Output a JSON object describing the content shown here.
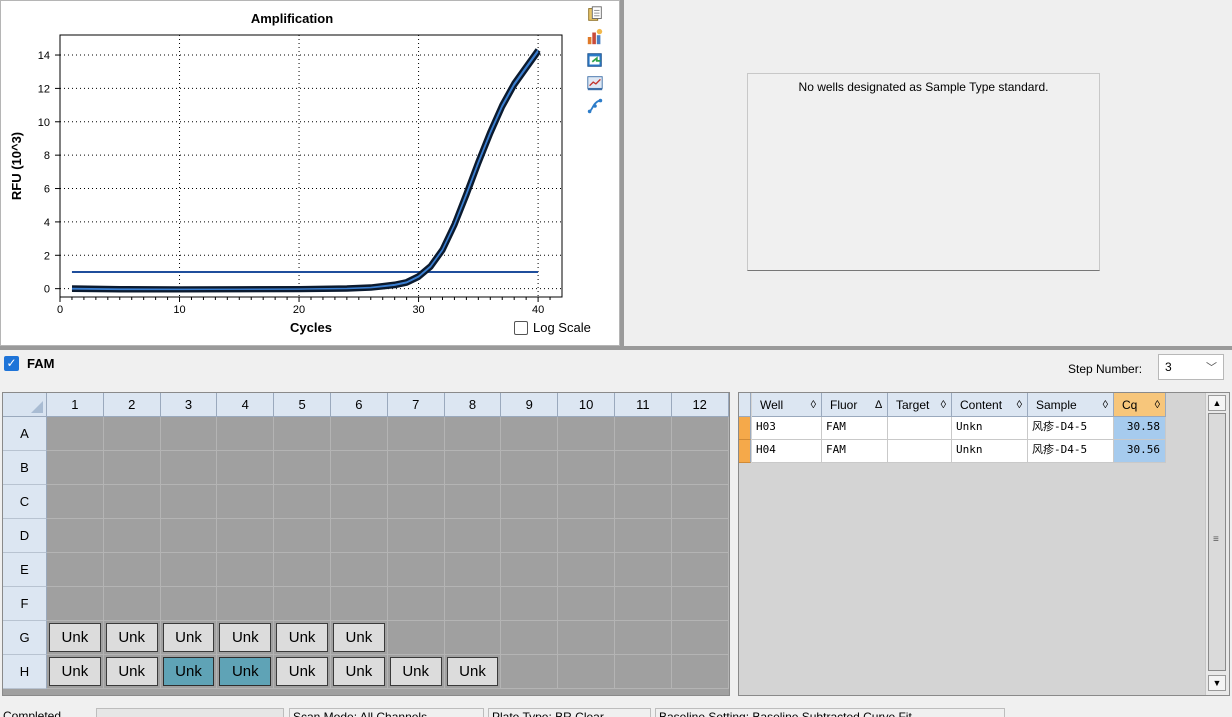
{
  "amplification": {
    "title": "Amplification",
    "log_scale_label": "Log Scale",
    "log_scale_checked": false,
    "toolbar_icons": [
      "copy-icon",
      "export-chart-icon",
      "refresh-icon",
      "chart-settings-icon",
      "curve-icon"
    ]
  },
  "chart_data": {
    "type": "line",
    "title": "Amplification",
    "xlabel": "Cycles",
    "ylabel": "RFU (10^3)",
    "xlim": [
      0,
      42
    ],
    "ylim": [
      -0.5,
      15.2
    ],
    "x_ticks": [
      0,
      10,
      20,
      30,
      40
    ],
    "y_ticks": [
      0,
      2,
      4,
      6,
      8,
      10,
      12,
      14
    ],
    "grid": true,
    "series": [
      {
        "x": [
          1,
          5,
          10,
          15,
          20,
          24,
          26,
          28,
          29,
          30,
          31,
          32,
          33,
          34,
          35,
          36,
          37,
          38,
          39,
          40
        ],
        "y": [
          -0.02,
          -0.05,
          -0.05,
          -0.04,
          -0.03,
          0.0,
          0.05,
          0.2,
          0.35,
          0.7,
          1.3,
          2.3,
          3.8,
          5.6,
          7.5,
          9.3,
          10.9,
          12.2,
          13.2,
          14.2
        ]
      },
      {
        "x": [
          1,
          5,
          10,
          15,
          20,
          24,
          26,
          28,
          29,
          30,
          31,
          32,
          33,
          34,
          35,
          36,
          37,
          38,
          39,
          40
        ],
        "y": [
          0.02,
          -0.02,
          -0.03,
          -0.03,
          -0.02,
          0.02,
          0.08,
          0.25,
          0.4,
          0.75,
          1.35,
          2.35,
          3.85,
          5.7,
          7.6,
          9.4,
          11.0,
          12.3,
          13.3,
          14.3
        ]
      }
    ],
    "threshold": 1.0,
    "threshold_x": [
      1,
      40
    ]
  },
  "standard_curve": {
    "message": "No wells designated as Sample Type standard."
  },
  "fluor": {
    "name": "FAM",
    "checked": true,
    "step_label": "Step Number:",
    "step_value": "3"
  },
  "plate": {
    "columns": [
      "1",
      "2",
      "3",
      "4",
      "5",
      "6",
      "7",
      "8",
      "9",
      "10",
      "11",
      "12"
    ],
    "rows": [
      "A",
      "B",
      "C",
      "D",
      "E",
      "F",
      "G",
      "H"
    ],
    "wells": [
      {
        "row": "G",
        "col": 1,
        "label": "Unk",
        "selected": false
      },
      {
        "row": "G",
        "col": 2,
        "label": "Unk",
        "selected": false
      },
      {
        "row": "G",
        "col": 3,
        "label": "Unk",
        "selected": false
      },
      {
        "row": "G",
        "col": 4,
        "label": "Unk",
        "selected": false
      },
      {
        "row": "G",
        "col": 5,
        "label": "Unk",
        "selected": false
      },
      {
        "row": "G",
        "col": 6,
        "label": "Unk",
        "selected": false
      },
      {
        "row": "H",
        "col": 1,
        "label": "Unk",
        "selected": false
      },
      {
        "row": "H",
        "col": 2,
        "label": "Unk",
        "selected": false
      },
      {
        "row": "H",
        "col": 3,
        "label": "Unk",
        "selected": true
      },
      {
        "row": "H",
        "col": 4,
        "label": "Unk",
        "selected": true
      },
      {
        "row": "H",
        "col": 5,
        "label": "Unk",
        "selected": false
      },
      {
        "row": "H",
        "col": 6,
        "label": "Unk",
        "selected": false
      },
      {
        "row": "H",
        "col": 7,
        "label": "Unk",
        "selected": false
      },
      {
        "row": "H",
        "col": 8,
        "label": "Unk",
        "selected": false
      }
    ]
  },
  "results_table": {
    "headers": [
      {
        "label": "Well",
        "sort": "◊"
      },
      {
        "label": "Fluor",
        "sort": "∆"
      },
      {
        "label": "Target",
        "sort": "◊"
      },
      {
        "label": "Content",
        "sort": "◊"
      },
      {
        "label": "Sample",
        "sort": "◊"
      },
      {
        "label": "Cq",
        "sort": "◊"
      }
    ],
    "rows": [
      [
        "H03",
        "FAM",
        "",
        "Unkn",
        "风疹-D4-5",
        "30.58"
      ],
      [
        "H04",
        "FAM",
        "",
        "Unkn",
        "风疹-D4-5",
        "30.56"
      ]
    ]
  },
  "status_bar": {
    "items": [
      "Completed",
      "",
      "Scan Mode: All Channels",
      "Plate Type: BR Clear",
      "Baseline Setting: Baseline Subtracted Curve Fit"
    ]
  },
  "colors": {
    "threshold": "#1f4e9c",
    "curve_outer": "#0b1a2e",
    "curve_inner": "#3b7fd1",
    "selected_well": "#5fa3b6",
    "cq_cell": "#a6cbee",
    "active_header": "#f7c67b",
    "row_marker": "#f5a94a"
  }
}
